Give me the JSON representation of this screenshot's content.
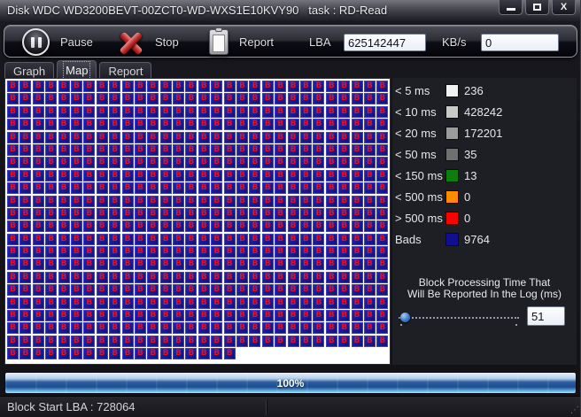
{
  "window": {
    "title": "Disk WDC WD3200BEVT-00ZCT0-WD-WXS1E10KVY90   task : RD-Read",
    "close_glyph": "X"
  },
  "toolbar": {
    "pause_label": "Pause",
    "stop_label": "Stop",
    "report_label": "Report",
    "lba_label": "LBA",
    "lba_value": "625142447",
    "kbs_label": "KB/s",
    "kbs_value": "0"
  },
  "tabs": [
    {
      "label": "Graph",
      "active": false
    },
    {
      "label": "Map",
      "active": true
    },
    {
      "label": "Report",
      "active": false
    }
  ],
  "map": {
    "columns": 30,
    "full_rows": 21,
    "last_row_cells": 18,
    "total_cells": 648,
    "cell_label": "B",
    "cell_color": "#19198f",
    "cell_border_color": "#4242c2",
    "cell_text_color": "#e01228",
    "background": "#ffffff"
  },
  "legend": {
    "rows": [
      {
        "label": "< 5 ms",
        "color": "#f2f2f2",
        "count": "236",
        "gap_before": false
      },
      {
        "label": "< 10 ms",
        "color": "#c9c9c9",
        "count": "428242",
        "gap_before": false
      },
      {
        "label": "< 20 ms",
        "color": "#9b9b9b",
        "count": "172201",
        "gap_before": false
      },
      {
        "label": "< 50 ms",
        "color": "#6f6f6f",
        "count": "35",
        "gap_before": false
      },
      {
        "label": "< 150 ms",
        "color": "#0d7d0d",
        "count": "13",
        "gap_before": false
      },
      {
        "label": "< 500 ms",
        "color": "#ff8c00",
        "count": "0",
        "gap_before": false
      },
      {
        "label": "> 500 ms",
        "color": "#fe0000",
        "count": "0",
        "gap_before": false
      },
      {
        "label": "Bads",
        "color": "#10108e",
        "count": "9764",
        "gap_before": true
      }
    ]
  },
  "log_time": {
    "caption_line1": "Block Processing Time That",
    "caption_line2": "Will Be Reported In the Log (ms)",
    "value": "51"
  },
  "progress": {
    "percent_label": "100%"
  },
  "status_bar": {
    "text": "Block Start LBA : 728064"
  }
}
